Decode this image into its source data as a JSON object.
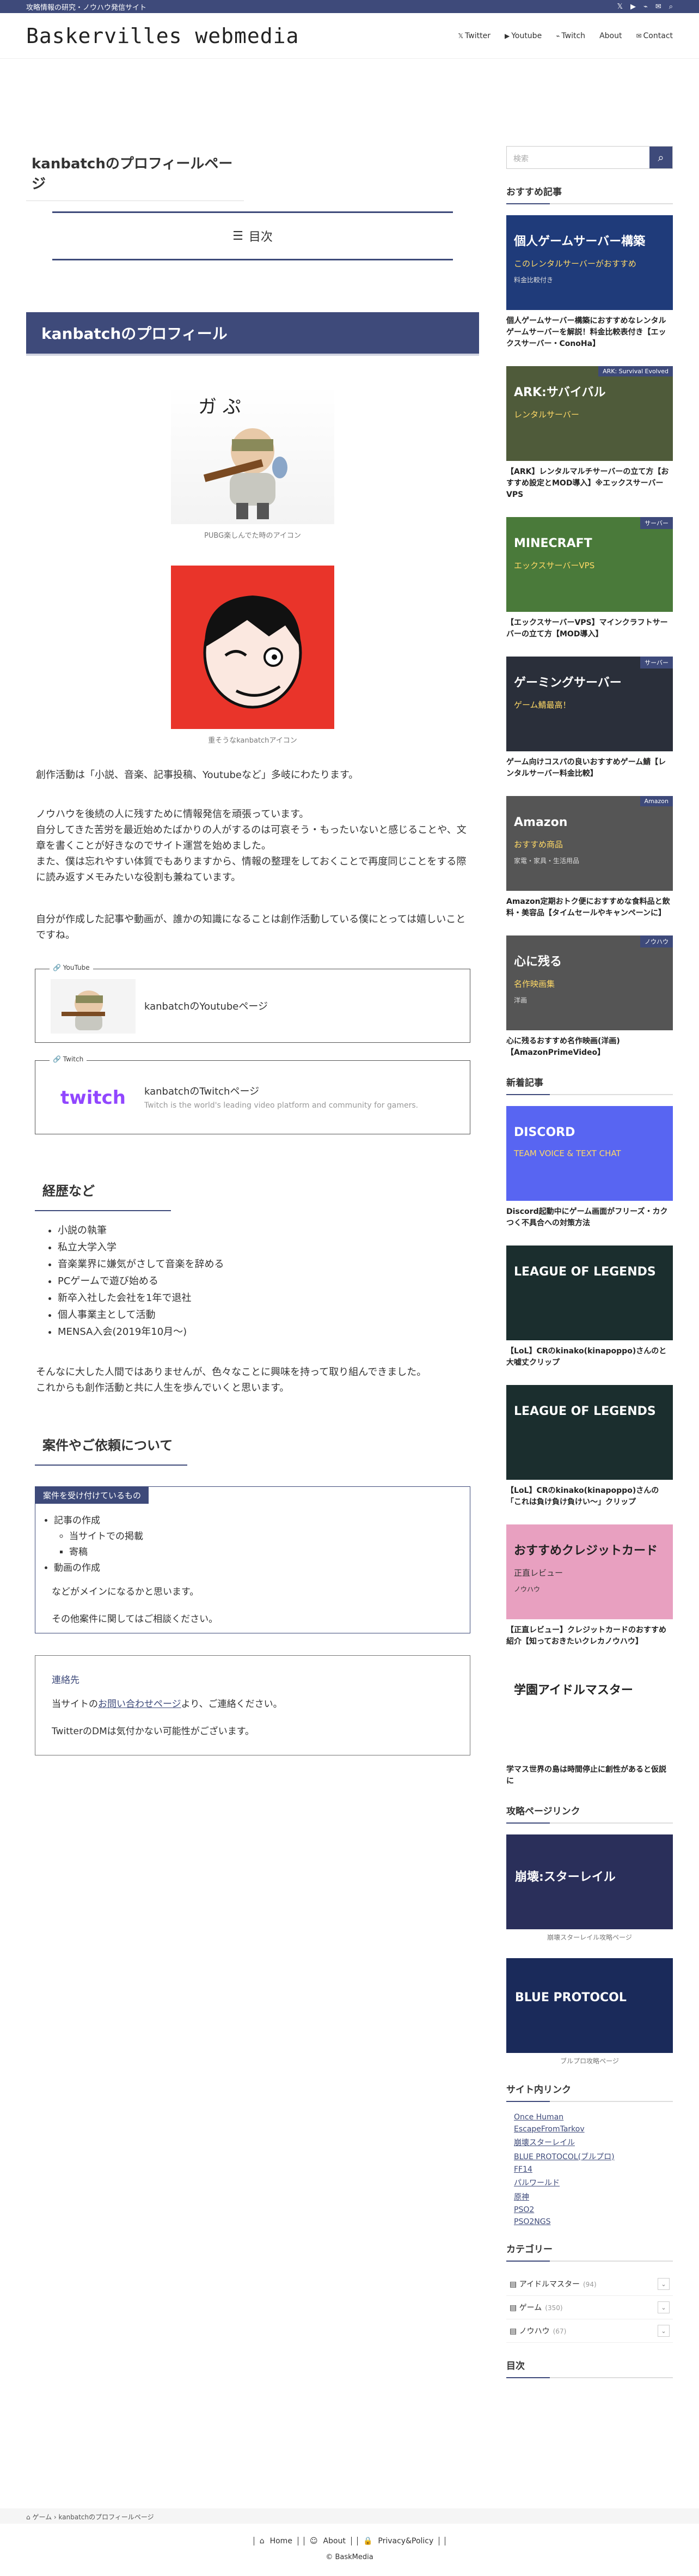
{
  "topbar": {
    "tagline": "攻略情報の研究・ノウハウ発信サイト"
  },
  "site": {
    "logo": "Baskervilles webmedia"
  },
  "nav": [
    {
      "icon": "𝕏",
      "label": "Twitter"
    },
    {
      "icon": "▶",
      "label": "Youtube"
    },
    {
      "icon": "⌁",
      "label": "Twitch"
    },
    {
      "icon": "",
      "label": "About"
    },
    {
      "icon": "✉",
      "label": "Contact"
    }
  ],
  "page": {
    "title": "kanbatchのプロフィールページ",
    "toc": "目次",
    "h2": "kanbatchのプロフィール"
  },
  "fig1": {
    "caption": "PUBG楽しんでた時のアイコン"
  },
  "fig2": {
    "caption": "重そうなkanbatchアイコン"
  },
  "intro": "創作活動は「小説、音楽、記事投稿、Youtubeなど」多岐にわたります。",
  "para2": [
    "ノウハウを後続の人に残すために情報発信を頑張っています。",
    "自分してきた苦労を最近始めたばかりの人がするのは可哀そう・もったいないと感じることや、文章を書くことが好きなのでサイト運営を始めました。",
    "また、僕は忘れやすい体質でもありますから、情報の整理をしておくことで再度同じことをする際に読み返すメモみたいな役割も兼ねています。"
  ],
  "para3": "自分が作成した記事や動画が、誰かの知識になることは創作活動している僕にとっては嬉しいことですね。",
  "youtube_card": {
    "tag": "YouTube",
    "title": "kanbatchのYoutubeページ"
  },
  "twitch_card": {
    "tag": "Twitch",
    "title": "kanbatchのTwitchページ",
    "desc": "Twitch is the world's leading video platform and community for gamers.",
    "logo": "twitch"
  },
  "history": {
    "heading": "経歴など",
    "items": [
      "小説の執筆",
      "私立大学入学",
      "音楽業界に嫌気がさして音楽を辞める",
      "PCゲームで遊び始める",
      "新卒入社した会社を1年で退社",
      "個人事業主として活動",
      "MENSA入会(2019年10月〜)"
    ],
    "text": [
      "そんなに大した人間ではありませんが、色々なことに興味を持って取り組んできました。",
      "これからも創作活動と共に人生を歩んでいくと思います。"
    ]
  },
  "request": {
    "heading": "案件やご依頼について",
    "box_title": "案件を受け付けているもの",
    "items": [
      "記事の作成",
      "当サイトでの掲載",
      "寄稿",
      "動画の作成"
    ],
    "text1": "などがメインになるかと思います。",
    "text2": "その他案件に関してはご相談ください。"
  },
  "contact": {
    "title": "連絡先",
    "pre": "当サイトの",
    "link": "お問い合わせページ",
    "post": "より、ご連絡ください。",
    "note": "TwitterのDMは気付かない可能性がございます。"
  },
  "sidebar": {
    "search_placeholder": "検索",
    "recommend_title": "おすすめ記事",
    "recommend": [
      {
        "img_text": "個人ゲームサーバー構築",
        "img_sub": "このレンタルサーバーがおすすめ",
        "img_sub2": "料金比較付き",
        "cat": "",
        "title": "個人ゲームサーバー構築におすすめなレンタルゲームサーバーを解説！料金比較表付き【エックスサーバー・ConoHa】",
        "bg": "#1f3b7a"
      },
      {
        "img_text": "ARK:サバイバル",
        "img_sub": "レンタルサーバー",
        "img_sub2": "",
        "cat": "ARK: Survival Evolved",
        "title": "【ARK】レンタルマルチサーバーの立て方【おすすめ設定とMOD導入】※エックスサーバーVPS",
        "bg": "#4f5b3a"
      },
      {
        "img_text": "MINECRAFT",
        "img_sub": "エックスサーバーVPS",
        "img_sub2": "",
        "cat": "サーバー",
        "title": "【エックスサーバーVPS】マインクラフトサーバーの立て方【MOD導入】",
        "bg": "#4a7a3a"
      },
      {
        "img_text": "ゲーミングサーバー",
        "img_sub": "ゲーム鯖最高！",
        "img_sub2": "",
        "cat": "サーバー",
        "title": "ゲーム向けコスパの良いおすすめゲーム鯖【レンタルサーバー料金比較】",
        "bg": "#2a2f3a"
      },
      {
        "img_text": "Amazon",
        "img_sub": "おすすめ商品",
        "img_sub2": "家電・家具・生活用品",
        "cat": "Amazon",
        "title": "Amazon定期おトク便におすすめな食料品と飲料・美容品【タイムセールやキャンペーンに】",
        "bg": "#555"
      },
      {
        "img_text": "心に残る",
        "img_sub": "名作映画集",
        "img_sub2": "洋画",
        "cat": "ノウハウ",
        "title": "心に残るおすすめ名作映画(洋画)【AmazonPrimeVideo】",
        "bg": "#555"
      }
    ],
    "new_title": "新着記事",
    "new": [
      {
        "img_text": "DISCORD",
        "img_sub": "TEAM VOICE & TEXT CHAT",
        "title": "Discord起動中にゲーム画面がフリーズ・カクつく不具合への対策方法",
        "bg": "#5865f2"
      },
      {
        "img_text": "LEAGUE OF LEGENDS",
        "img_sub": "",
        "title": "【LoL】CRのkinako(kinapoppo)さんのと大嘘丈クリップ",
        "bg": "#1b2e2e"
      },
      {
        "img_text": "LEAGUE OF LEGENDS",
        "img_sub": "",
        "title": "【LoL】CRのkinako(kinapoppo)さんの「これは負け負け負けい〜」クリップ",
        "bg": "#1b2e2e"
      },
      {
        "img_text": "おすすめクレジットカード",
        "img_sub": "正直レビュー",
        "img_sub2": "ノウハウ",
        "title": "【正直レビュー】クレジットカードのおすすめ紹介【知っておきたいクレカノウハウ】",
        "bg": "#e8a0c0"
      },
      {
        "img_text": "学園アイドルマスター",
        "img_sub": "",
        "title": "学マス世界の島は時間停止に創性があると仮説に",
        "bg": "#fff"
      }
    ],
    "guide_title": "攻略ページリンク",
    "guides": [
      {
        "caption": "崩壊スターレイル攻略ページ",
        "img_text": "崩壊:スターレイル",
        "bg": "#2a2f5a"
      },
      {
        "caption": "ブルプロ攻略ページ",
        "img_text": "BLUE PROTOCOL",
        "bg": "#1a2a5a"
      }
    ],
    "sitelinks_title": "サイト内リンク",
    "sitelinks": [
      "Once Human",
      "EscapeFromTarkov",
      "崩壊スターレイル",
      "BLUE PROTOCOL(ブルプロ)",
      "FF14",
      "パルワールド",
      "原神",
      "PSO2",
      "PSO2NGS"
    ],
    "category_title": "カテゴリー",
    "categories": [
      {
        "name": "アイドルマスター",
        "count": "(94)"
      },
      {
        "name": "ゲーム",
        "count": "(350)"
      },
      {
        "name": "ノウハウ",
        "count": "(67)"
      }
    ],
    "toc_title": "目次"
  },
  "breadcrumb": {
    "home": "ゲーム",
    "current": "kanbatchのプロフィールページ"
  },
  "footer": {
    "links": [
      "Home",
      "About",
      "Privacy&Policy"
    ],
    "copyright": "© BaskMedia"
  }
}
